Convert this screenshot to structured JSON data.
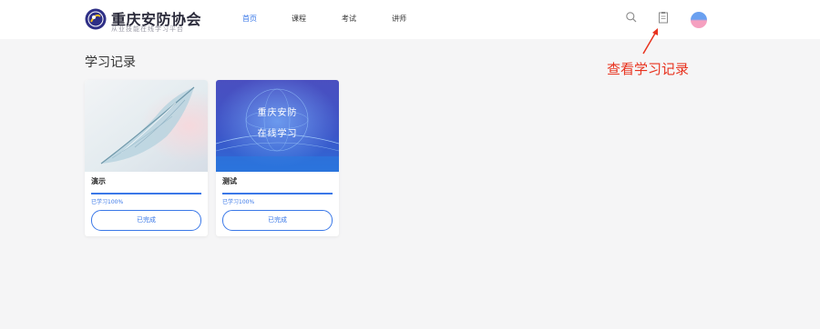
{
  "header": {
    "logo_title": "重庆安防协会",
    "logo_subtitle": "从业技能在线学习平台",
    "nav": [
      {
        "label": "首页",
        "active": true
      },
      {
        "label": "课程",
        "active": false
      },
      {
        "label": "考试",
        "active": false
      },
      {
        "label": "讲师",
        "active": false
      }
    ],
    "icons": [
      "search-icon",
      "clipboard-icon",
      "avatar"
    ]
  },
  "annotation": {
    "text": "查看学习记录",
    "color": "#e8321e"
  },
  "page": {
    "title": "学习记录"
  },
  "cards": [
    {
      "name": "演示",
      "cover": "feather",
      "progress_text": "已学习100%",
      "progress": 1.0,
      "button_label": "已完成"
    },
    {
      "name": "测试",
      "cover": "globe",
      "cover_line1": "重庆安防",
      "cover_line2": "在线学习",
      "progress_text": "已学习100%",
      "progress": 1.0,
      "button_label": "已完成"
    }
  ],
  "colors": {
    "accent": "#3a78e8",
    "background": "#f5f5f6",
    "annotation": "#e8321e"
  }
}
